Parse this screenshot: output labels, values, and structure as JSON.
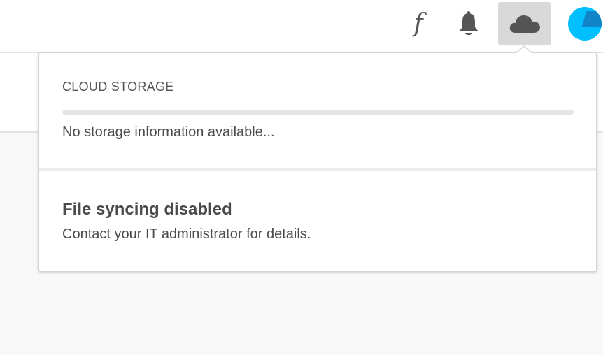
{
  "header": {
    "fonts_glyph": "f",
    "icons": {
      "fonts": "fonts-icon",
      "notifications": "bell-icon",
      "cloud": "cloud-icon",
      "avatar": "avatar"
    }
  },
  "popover": {
    "storage": {
      "heading": "CLOUD STORAGE",
      "used_fraction": 0,
      "message": "No storage information available..."
    },
    "sync": {
      "title": "File syncing disabled",
      "description": "Contact your IT administrator for details."
    }
  },
  "colors": {
    "icon": "#555555",
    "cloud_button_active_bg": "#d9d9d9",
    "avatar_primary": "#00bfff",
    "avatar_secondary": "#1185c7"
  }
}
